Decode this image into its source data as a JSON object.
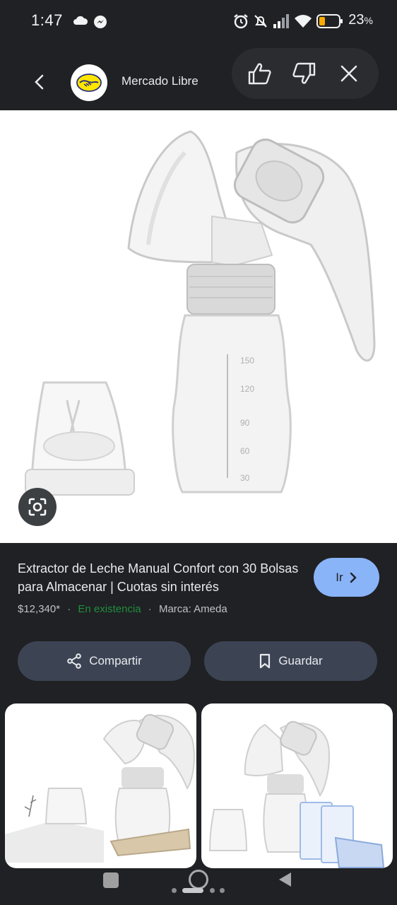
{
  "status_bar": {
    "time": "1:47",
    "battery_percent": "23",
    "icons": [
      "cloud-icon",
      "messenger-icon",
      "alarm-icon",
      "mute-icon",
      "signal-icon",
      "wifi-icon",
      "battery-icon"
    ]
  },
  "app_bar": {
    "site_name": "Mercado Libre",
    "icons": [
      "back-arrow-icon",
      "thumbs-up-icon",
      "thumbs-down-icon",
      "close-icon"
    ]
  },
  "product": {
    "title": "Extractor de Leche Manual Confort con 30 Bolsas para Almacenar | Cuotas sin interés",
    "price": "$12,340*",
    "stock": "En existencia",
    "brand": "Marca: Ameda",
    "go_label": "Ir"
  },
  "actions": {
    "share_label": "Compartir",
    "save_label": "Guardar"
  },
  "colors": {
    "background": "#202124",
    "accent": "#8ab4f8",
    "stock_green": "#1e8e3e",
    "pill": "#3c4454"
  }
}
